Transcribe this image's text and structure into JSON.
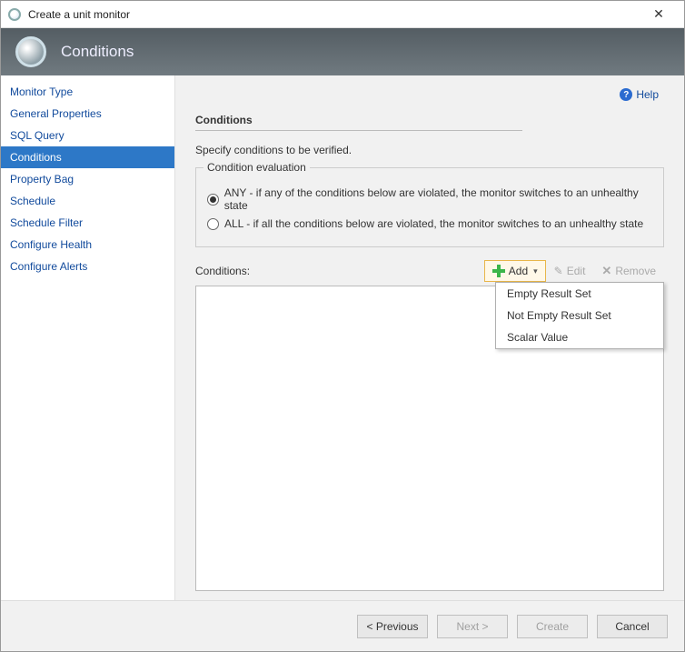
{
  "window": {
    "title": "Create a unit monitor"
  },
  "banner": {
    "title": "Conditions"
  },
  "help": {
    "label": "Help"
  },
  "sidebar": {
    "items": [
      {
        "label": "Monitor Type"
      },
      {
        "label": "General Properties"
      },
      {
        "label": "SQL Query"
      },
      {
        "label": "Conditions"
      },
      {
        "label": "Property Bag"
      },
      {
        "label": "Schedule"
      },
      {
        "label": "Schedule Filter"
      },
      {
        "label": "Configure Health"
      },
      {
        "label": "Configure Alerts"
      }
    ]
  },
  "main": {
    "section_title": "Conditions",
    "subtext": "Specify conditions to be verified.",
    "fieldset_legend": "Condition evaluation",
    "radio_any": "ANY - if any of the conditions below are violated, the monitor switches to an unhealthy state",
    "radio_all": "ALL - if all the conditions below are violated, the monitor switches to an unhealthy state",
    "conditions_label": "Conditions:",
    "add_label": "Add",
    "edit_label": "Edit",
    "remove_label": "Remove",
    "dropdown": {
      "items": [
        {
          "label": "Empty Result Set"
        },
        {
          "label": "Not Empty Result Set"
        },
        {
          "label": "Scalar Value"
        }
      ]
    }
  },
  "footer": {
    "previous": "< Previous",
    "next": "Next >",
    "create": "Create",
    "cancel": "Cancel"
  }
}
